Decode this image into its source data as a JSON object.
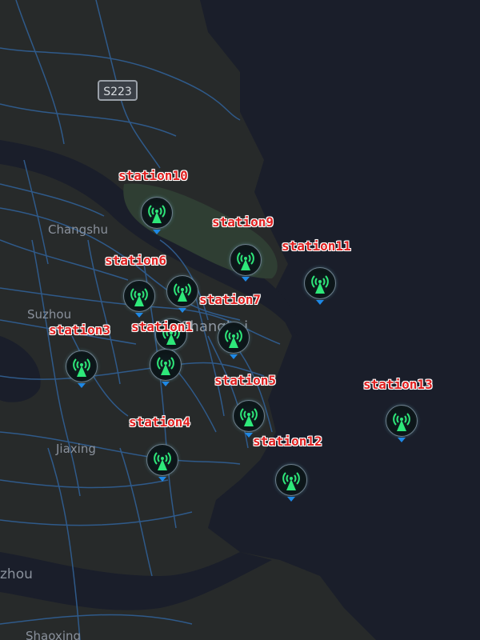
{
  "map": {
    "route_shield": "S223",
    "places": [
      {
        "id": "changshu",
        "name": "Changshu"
      },
      {
        "id": "suzhou",
        "name": "Suzhou"
      },
      {
        "id": "shanghai",
        "name": "Shanghai"
      },
      {
        "id": "jiaxing",
        "name": "Jiaxing"
      },
      {
        "id": "hangzhou",
        "name": "zhou"
      },
      {
        "id": "shaoxing",
        "name": "Shaoxing"
      }
    ],
    "colors": {
      "water": "#1a1e2a",
      "land": "#272a2a",
      "roads": "#2f5a8a",
      "label": "#e02020",
      "marker_icon": "#2ee87a",
      "marker_tip": "#1e88e5"
    },
    "marker_icon": "radio-tower-icon"
  },
  "stations": [
    {
      "id": "station10",
      "label": "station10"
    },
    {
      "id": "station9",
      "label": "station9"
    },
    {
      "id": "station11",
      "label": "station11"
    },
    {
      "id": "station6",
      "label": "station6"
    },
    {
      "id": "station7",
      "label": "station7"
    },
    {
      "id": "station1",
      "label": "station1"
    },
    {
      "id": "station3",
      "label": "station3"
    },
    {
      "id": "station5",
      "label": "station5"
    },
    {
      "id": "station13",
      "label": "station13"
    },
    {
      "id": "station4",
      "label": "station4"
    },
    {
      "id": "station12",
      "label": "station12"
    },
    {
      "id": "station_unlabeled",
      "label": ""
    }
  ]
}
